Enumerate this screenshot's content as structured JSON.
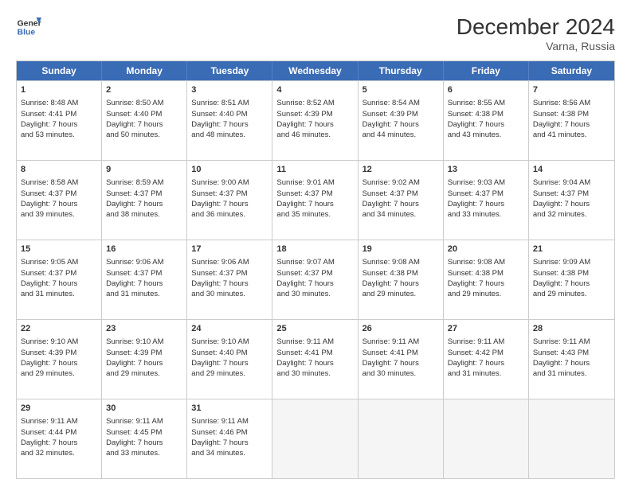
{
  "header": {
    "logo_line1": "General",
    "logo_line2": "Blue",
    "month_title": "December 2024",
    "location": "Varna, Russia"
  },
  "days_of_week": [
    "Sunday",
    "Monday",
    "Tuesday",
    "Wednesday",
    "Thursday",
    "Friday",
    "Saturday"
  ],
  "weeks": [
    [
      {
        "day": "1",
        "lines": [
          "Sunrise: 8:48 AM",
          "Sunset: 4:41 PM",
          "Daylight: 7 hours",
          "and 53 minutes."
        ]
      },
      {
        "day": "2",
        "lines": [
          "Sunrise: 8:50 AM",
          "Sunset: 4:40 PM",
          "Daylight: 7 hours",
          "and 50 minutes."
        ]
      },
      {
        "day": "3",
        "lines": [
          "Sunrise: 8:51 AM",
          "Sunset: 4:40 PM",
          "Daylight: 7 hours",
          "and 48 minutes."
        ]
      },
      {
        "day": "4",
        "lines": [
          "Sunrise: 8:52 AM",
          "Sunset: 4:39 PM",
          "Daylight: 7 hours",
          "and 46 minutes."
        ]
      },
      {
        "day": "5",
        "lines": [
          "Sunrise: 8:54 AM",
          "Sunset: 4:39 PM",
          "Daylight: 7 hours",
          "and 44 minutes."
        ]
      },
      {
        "day": "6",
        "lines": [
          "Sunrise: 8:55 AM",
          "Sunset: 4:38 PM",
          "Daylight: 7 hours",
          "and 43 minutes."
        ]
      },
      {
        "day": "7",
        "lines": [
          "Sunrise: 8:56 AM",
          "Sunset: 4:38 PM",
          "Daylight: 7 hours",
          "and 41 minutes."
        ]
      }
    ],
    [
      {
        "day": "8",
        "lines": [
          "Sunrise: 8:58 AM",
          "Sunset: 4:37 PM",
          "Daylight: 7 hours",
          "and 39 minutes."
        ]
      },
      {
        "day": "9",
        "lines": [
          "Sunrise: 8:59 AM",
          "Sunset: 4:37 PM",
          "Daylight: 7 hours",
          "and 38 minutes."
        ]
      },
      {
        "day": "10",
        "lines": [
          "Sunrise: 9:00 AM",
          "Sunset: 4:37 PM",
          "Daylight: 7 hours",
          "and 36 minutes."
        ]
      },
      {
        "day": "11",
        "lines": [
          "Sunrise: 9:01 AM",
          "Sunset: 4:37 PM",
          "Daylight: 7 hours",
          "and 35 minutes."
        ]
      },
      {
        "day": "12",
        "lines": [
          "Sunrise: 9:02 AM",
          "Sunset: 4:37 PM",
          "Daylight: 7 hours",
          "and 34 minutes."
        ]
      },
      {
        "day": "13",
        "lines": [
          "Sunrise: 9:03 AM",
          "Sunset: 4:37 PM",
          "Daylight: 7 hours",
          "and 33 minutes."
        ]
      },
      {
        "day": "14",
        "lines": [
          "Sunrise: 9:04 AM",
          "Sunset: 4:37 PM",
          "Daylight: 7 hours",
          "and 32 minutes."
        ]
      }
    ],
    [
      {
        "day": "15",
        "lines": [
          "Sunrise: 9:05 AM",
          "Sunset: 4:37 PM",
          "Daylight: 7 hours",
          "and 31 minutes."
        ]
      },
      {
        "day": "16",
        "lines": [
          "Sunrise: 9:06 AM",
          "Sunset: 4:37 PM",
          "Daylight: 7 hours",
          "and 31 minutes."
        ]
      },
      {
        "day": "17",
        "lines": [
          "Sunrise: 9:06 AM",
          "Sunset: 4:37 PM",
          "Daylight: 7 hours",
          "and 30 minutes."
        ]
      },
      {
        "day": "18",
        "lines": [
          "Sunrise: 9:07 AM",
          "Sunset: 4:37 PM",
          "Daylight: 7 hours",
          "and 30 minutes."
        ]
      },
      {
        "day": "19",
        "lines": [
          "Sunrise: 9:08 AM",
          "Sunset: 4:38 PM",
          "Daylight: 7 hours",
          "and 29 minutes."
        ]
      },
      {
        "day": "20",
        "lines": [
          "Sunrise: 9:08 AM",
          "Sunset: 4:38 PM",
          "Daylight: 7 hours",
          "and 29 minutes."
        ]
      },
      {
        "day": "21",
        "lines": [
          "Sunrise: 9:09 AM",
          "Sunset: 4:38 PM",
          "Daylight: 7 hours",
          "and 29 minutes."
        ]
      }
    ],
    [
      {
        "day": "22",
        "lines": [
          "Sunrise: 9:10 AM",
          "Sunset: 4:39 PM",
          "Daylight: 7 hours",
          "and 29 minutes."
        ]
      },
      {
        "day": "23",
        "lines": [
          "Sunrise: 9:10 AM",
          "Sunset: 4:39 PM",
          "Daylight: 7 hours",
          "and 29 minutes."
        ]
      },
      {
        "day": "24",
        "lines": [
          "Sunrise: 9:10 AM",
          "Sunset: 4:40 PM",
          "Daylight: 7 hours",
          "and 29 minutes."
        ]
      },
      {
        "day": "25",
        "lines": [
          "Sunrise: 9:11 AM",
          "Sunset: 4:41 PM",
          "Daylight: 7 hours",
          "and 30 minutes."
        ]
      },
      {
        "day": "26",
        "lines": [
          "Sunrise: 9:11 AM",
          "Sunset: 4:41 PM",
          "Daylight: 7 hours",
          "and 30 minutes."
        ]
      },
      {
        "day": "27",
        "lines": [
          "Sunrise: 9:11 AM",
          "Sunset: 4:42 PM",
          "Daylight: 7 hours",
          "and 31 minutes."
        ]
      },
      {
        "day": "28",
        "lines": [
          "Sunrise: 9:11 AM",
          "Sunset: 4:43 PM",
          "Daylight: 7 hours",
          "and 31 minutes."
        ]
      }
    ],
    [
      {
        "day": "29",
        "lines": [
          "Sunrise: 9:11 AM",
          "Sunset: 4:44 PM",
          "Daylight: 7 hours",
          "and 32 minutes."
        ]
      },
      {
        "day": "30",
        "lines": [
          "Sunrise: 9:11 AM",
          "Sunset: 4:45 PM",
          "Daylight: 7 hours",
          "and 33 minutes."
        ]
      },
      {
        "day": "31",
        "lines": [
          "Sunrise: 9:11 AM",
          "Sunset: 4:46 PM",
          "Daylight: 7 hours",
          "and 34 minutes."
        ]
      },
      {
        "day": "",
        "lines": []
      },
      {
        "day": "",
        "lines": []
      },
      {
        "day": "",
        "lines": []
      },
      {
        "day": "",
        "lines": []
      }
    ]
  ]
}
